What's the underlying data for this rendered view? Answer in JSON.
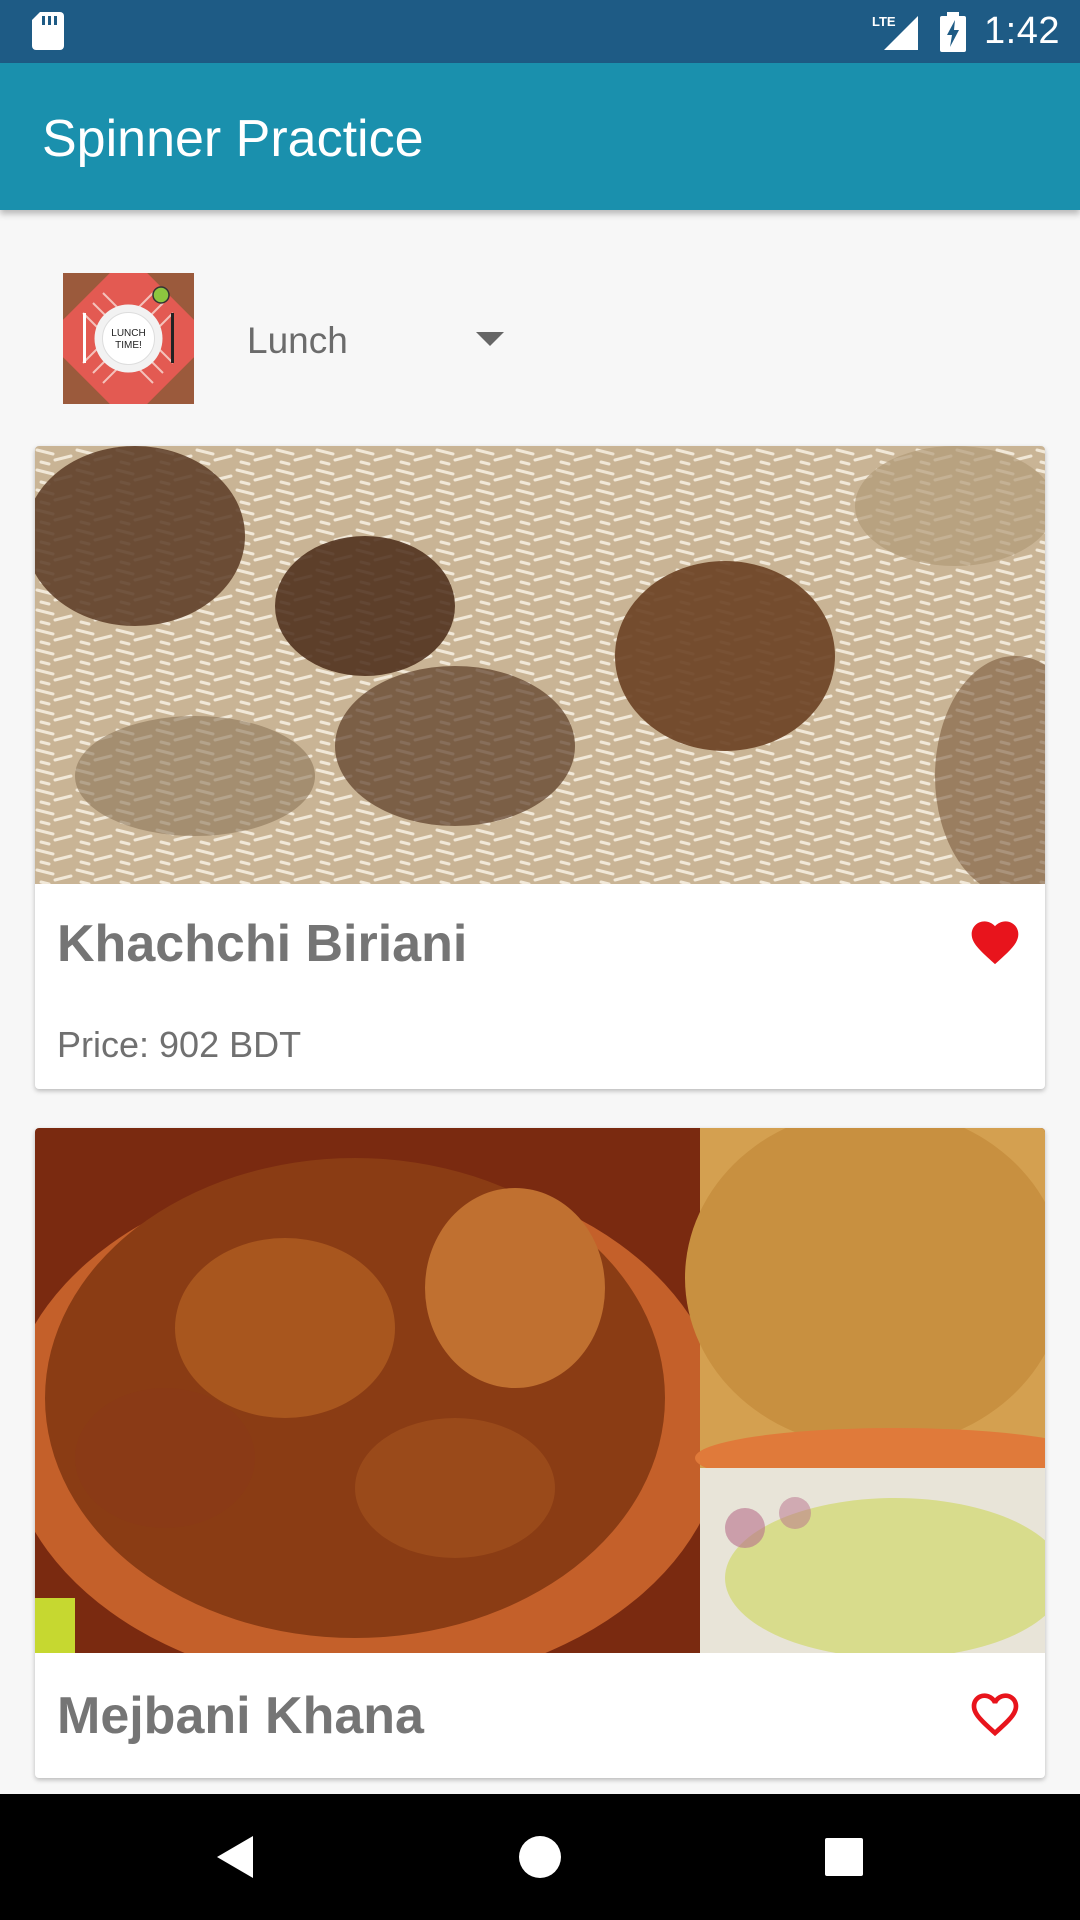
{
  "status_bar": {
    "time": "1:42",
    "network": "LTE"
  },
  "app_bar": {
    "title": "Spinner Practice"
  },
  "spinner": {
    "selected": "Lunch",
    "thumb_text_line1": "LUNCH",
    "thumb_text_line2": "TIME!"
  },
  "cards": [
    {
      "name": "Khachchi Biriani",
      "price": "Price: 902 BDT",
      "favorite": true
    },
    {
      "name": "Mejbani Khana",
      "favorite": false
    }
  ],
  "colors": {
    "status_bar": "#1e5b85",
    "app_bar": "#1a90ad",
    "heart": "#e8141c"
  },
  "icons": {
    "sd_card": "sd-card-icon",
    "signal": "signal-icon",
    "battery": "battery-charging-icon",
    "back": "back-icon",
    "home": "home-icon",
    "recents": "recents-icon"
  }
}
